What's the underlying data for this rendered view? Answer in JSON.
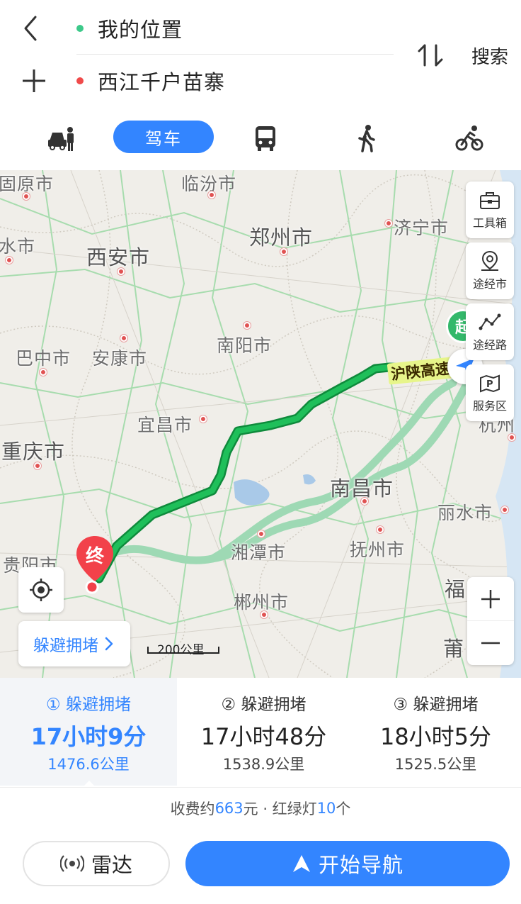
{
  "header": {
    "start_label": "我的位置",
    "end_label": "西江千户苗寨",
    "search_label": "搜索"
  },
  "modes": {
    "drive_label": "驾车",
    "icons": [
      "taxi-icon",
      "bus-icon",
      "walk-icon",
      "bike-icon"
    ]
  },
  "map": {
    "cities": [
      {
        "name": "固原市"
      },
      {
        "name": "临汾市"
      },
      {
        "name": "济宁市"
      },
      {
        "name": "水市"
      },
      {
        "name": "西安市"
      },
      {
        "name": "郑州市"
      },
      {
        "name": "巴中市"
      },
      {
        "name": "安康市"
      },
      {
        "name": "南阳市"
      },
      {
        "name": "宜昌市"
      },
      {
        "name": "重庆市"
      },
      {
        "name": "南昌市"
      },
      {
        "name": "丽水市"
      },
      {
        "name": "杭州"
      },
      {
        "name": "贵阳市"
      },
      {
        "name": "湘潭市"
      },
      {
        "name": "抚州市"
      },
      {
        "name": "郴州市"
      },
      {
        "name": "福"
      },
      {
        "name": "莆"
      }
    ],
    "highway_label": "沪陕高速",
    "start_marker": "起",
    "end_marker": "终",
    "scale_label": "200公里",
    "tools": {
      "toolbox": "工具箱",
      "via_city": "途经市",
      "via_road": "途经路",
      "service": "服务区"
    },
    "avoid_label": "躲避拥堵"
  },
  "routes": [
    {
      "tag": "① 躲避拥堵",
      "time": "17小时9分",
      "distance": "1476.6公里"
    },
    {
      "tag": "② 躲避拥堵",
      "time": "17小时48分",
      "distance": "1538.9公里"
    },
    {
      "tag": "③ 躲避拥堵",
      "time": "18小时5分",
      "distance": "1525.5公里"
    }
  ],
  "summary": {
    "toll_prefix": "收费约",
    "toll_value": "663",
    "toll_suffix": "元 · 红绿灯",
    "lights_value": "10",
    "lights_suffix": "个"
  },
  "actions": {
    "radar_label": "雷达",
    "navigate_label": "开始导航"
  },
  "colors": {
    "accent": "#3385ff",
    "route_primary": "#1aa84e",
    "route_alt": "#9ed9b4",
    "start_dot": "#3dc98a",
    "end_dot": "#f04a4a"
  }
}
